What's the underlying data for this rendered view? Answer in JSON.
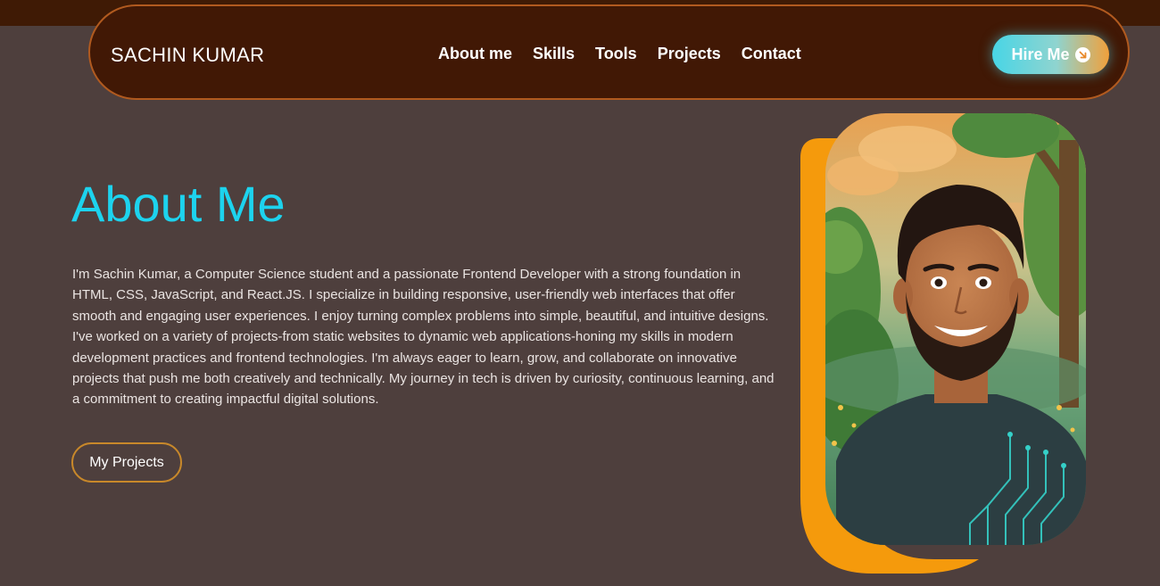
{
  "brand": {
    "name": "SACHIN KUMAR"
  },
  "nav": {
    "links": [
      {
        "label": "About me"
      },
      {
        "label": "Skills"
      },
      {
        "label": "Tools"
      },
      {
        "label": "Projects"
      },
      {
        "label": "Contact"
      }
    ],
    "cta_label": "Hire Me",
    "cta_icon": "arrow-circle-icon"
  },
  "about": {
    "title": "About Me",
    "description": "I'm Sachin Kumar, a Computer Science student and a passionate Frontend Developer with a strong foundation in HTML, CSS, JavaScript, and React.JS. I specialize in building responsive, user-friendly web interfaces that offer smooth and engaging user experiences. I enjoy turning complex problems into simple, beautiful, and intuitive designs. I've worked on a variety of projects-from static websites to dynamic web applications-honing my skills in modern development practices and frontend technologies. I'm always eager to learn, grow, and collaborate on innovative projects that push me both creatively and technically. My journey in tech is driven by curiosity, continuous learning, and a commitment to creating impactful digital solutions.",
    "button_label": "My Projects"
  },
  "colors": {
    "background": "#4e3f3d",
    "navbar": "#411805",
    "accent_cyan": "#1dd3ee",
    "accent_orange": "#f59a0c"
  }
}
